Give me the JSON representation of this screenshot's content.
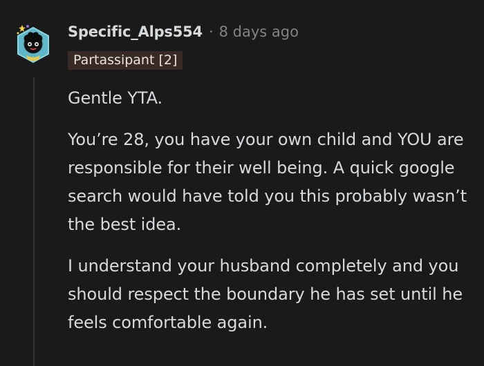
{
  "comment": {
    "username": "Specific_Alps554",
    "separator": "·",
    "timestamp": "8 days ago",
    "flair": "Partassipant [2]",
    "paragraphs": [
      "Gentle YTA.",
      "You’re 28, you have your own child and YOU are responsible for their well being. A quick google search would have told you this probably wasn’t the best idea.",
      "I understand your husband completely and you should respect the boundary he has set until he feels comfortable again."
    ]
  },
  "colors": {
    "background": "#1a1a1b",
    "text": "#d7dadc",
    "meta": "#818384",
    "flair_bg": "#3a2a26",
    "thread_line": "#343536"
  },
  "icons": {
    "avatar": "snoo-avatar-icon"
  }
}
